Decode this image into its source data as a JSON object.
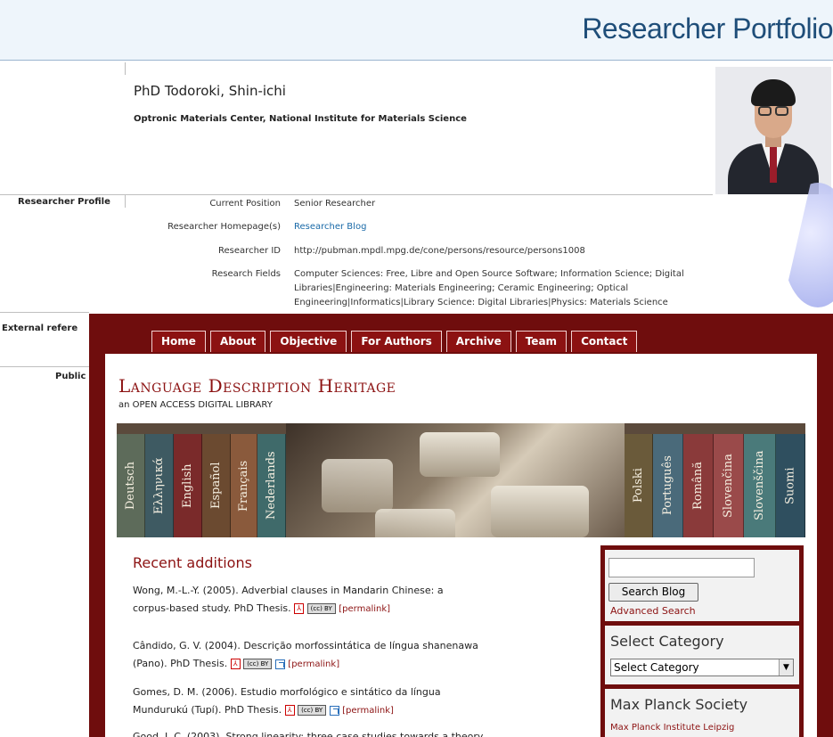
{
  "portfolio": {
    "title": "Researcher Portfolio",
    "name": "PhD Todoroki, Shin-ichi",
    "affiliation": "Optronic Materials Center, National Institute for Materials Science",
    "sections": {
      "profile": "Researcher Profile",
      "external": "External refere",
      "publications": "Public"
    },
    "rows": [
      {
        "label": "Current Position",
        "value": "Senior Researcher"
      },
      {
        "label": "Researcher Homepage(s)",
        "value": "Researcher Blog"
      },
      {
        "label": "Researcher ID",
        "value": "http://pubman.mpdl.mpg.de/cone/persons/resource/persons1008"
      },
      {
        "label": "Research Fields",
        "value": "Computer Sciences: Free, Libre and Open Source Software; Information Science; Digital Libraries|Engineering: Materials Engineering; Ceramic Engineering; Optical Engineering|Informatics|Library Science: Digital Libraries|Physics: Materials Science"
      }
    ]
  },
  "ldh": {
    "nav": [
      "Home",
      "About",
      "Objective",
      "For Authors",
      "Archive",
      "Team",
      "Contact"
    ],
    "title": "Language Description Heritage",
    "subtitle": "an OPEN ACCESS DIGITAL LIBRARY",
    "banner_books_left": [
      "Deutsch",
      "Ελληνικά",
      "English",
      "Español",
      "Français",
      "Nederlands"
    ],
    "banner_books_right": [
      "Polski",
      "Português",
      "Română",
      "Slovenčina",
      "Slovenščina",
      "Suomi"
    ],
    "recent_title": "Recent additions",
    "entries": [
      {
        "line1": "Wong, M.-L.-Y. (2005). Adverbial clauses in Mandarin Chinese: a",
        "line2": "corpus-based study. PhD Thesis."
      },
      {
        "line1": "Cândido, G. V. (2004). Descrição morfossintática de língua shanenawa",
        "line2": "(Pano). PhD Thesis."
      },
      {
        "line1": "Gomes, D. M. (2006). Estudio morfológico e sintático da língua",
        "line2": "Mundurukú (Tupí). PhD Thesis."
      },
      {
        "line1": "Good, J. C. (2003). Strong linearity: three case studies towards a theory",
        "line2": ""
      }
    ],
    "permalink": "[permalink]",
    "cc_label": "(cc) BY",
    "sidebar": {
      "search_value": "",
      "search_button": "Search Blog",
      "advanced_search": "Advanced Search",
      "category_title": "Select Category",
      "category_selected": "Select Category",
      "mps_title": "Max Planck Society",
      "mps_link": "Max Planck Institute Leipzig"
    }
  },
  "colors": {
    "ldh_maroon": "#6f0d0d",
    "ldh_accent": "#8c1212",
    "portfolio_title": "#1f4e79",
    "link_blue": "#1a6aa8"
  }
}
